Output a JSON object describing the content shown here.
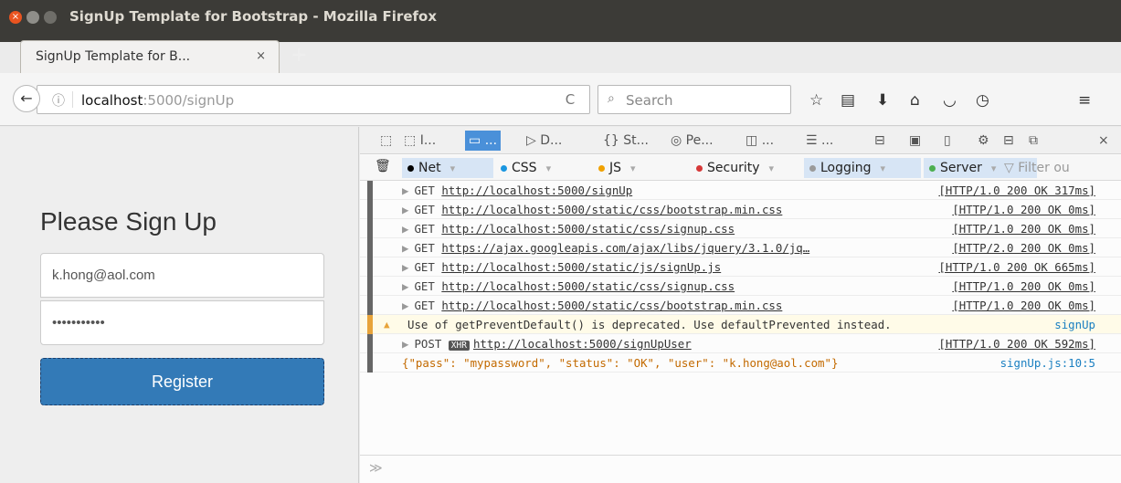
{
  "window": {
    "title": "SignUp Template for Bootstrap - Mozilla Firefox"
  },
  "tab": {
    "label": "SignUp Template for B...",
    "close": "×",
    "new_tab": "+"
  },
  "navbar": {
    "back": "←",
    "info": "ⓘ",
    "url_host": "localhost",
    "url_rest": ":5000/signUp",
    "reload": "C",
    "search_placeholder": "Search",
    "icons": [
      "star-icon",
      "reading-list-icon",
      "download-icon",
      "home-icon",
      "pocket-icon",
      "history-icon",
      "menu-icon"
    ]
  },
  "page": {
    "title": "Please Sign Up",
    "email_value": "k.hong@aol.com",
    "password_value": "•••••••••••",
    "register_label": "Register"
  },
  "devtools": {
    "tabs": [
      "I...",
      "...",
      "D...",
      "St...",
      "Pe...",
      "...",
      "..."
    ],
    "filters": {
      "net": "Net",
      "css": "CSS",
      "js": "JS",
      "security": "Security",
      "logging": "Logging",
      "server": "Server",
      "filter_placeholder": "Filter ou"
    },
    "log": [
      {
        "method": "GET",
        "url": "http://localhost:5000/signUp",
        "status": "[HTTP/1.0 200 OK 317ms]"
      },
      {
        "method": "GET",
        "url": "http://localhost:5000/static/css/bootstrap.min.css",
        "status": "[HTTP/1.0 200 OK 0ms]"
      },
      {
        "method": "GET",
        "url": "http://localhost:5000/static/css/signup.css",
        "status": "[HTTP/1.0 200 OK 0ms]"
      },
      {
        "method": "GET",
        "url": "https://ajax.googleapis.com/ajax/libs/jquery/3.1.0/jq…",
        "status": "[HTTP/2.0 200 OK 0ms]"
      },
      {
        "method": "GET",
        "url": "http://localhost:5000/static/js/signUp.js",
        "status": "[HTTP/1.0 200 OK 665ms]"
      },
      {
        "method": "GET",
        "url": "http://localhost:5000/static/css/signup.css",
        "status": "[HTTP/1.0 200 OK 0ms]"
      },
      {
        "method": "GET",
        "url": "http://localhost:5000/static/css/bootstrap.min.css",
        "status": "[HTTP/1.0 200 OK 0ms]"
      }
    ],
    "warning": {
      "text": "Use of getPreventDefault() is deprecated. Use defaultPrevented instead.",
      "source": "signUp"
    },
    "post": {
      "method": "POST",
      "badge": "XHR",
      "url": "http://localhost:5000/signUpUser",
      "status": "[HTTP/1.0 200 OK 592ms]"
    },
    "response": {
      "text": "{\"pass\": \"mypassword\", \"status\": \"OK\", \"user\": \"k.hong@aol.com\"}",
      "source": "signUp.js:10:5"
    },
    "cmd_prompt": "≫"
  }
}
